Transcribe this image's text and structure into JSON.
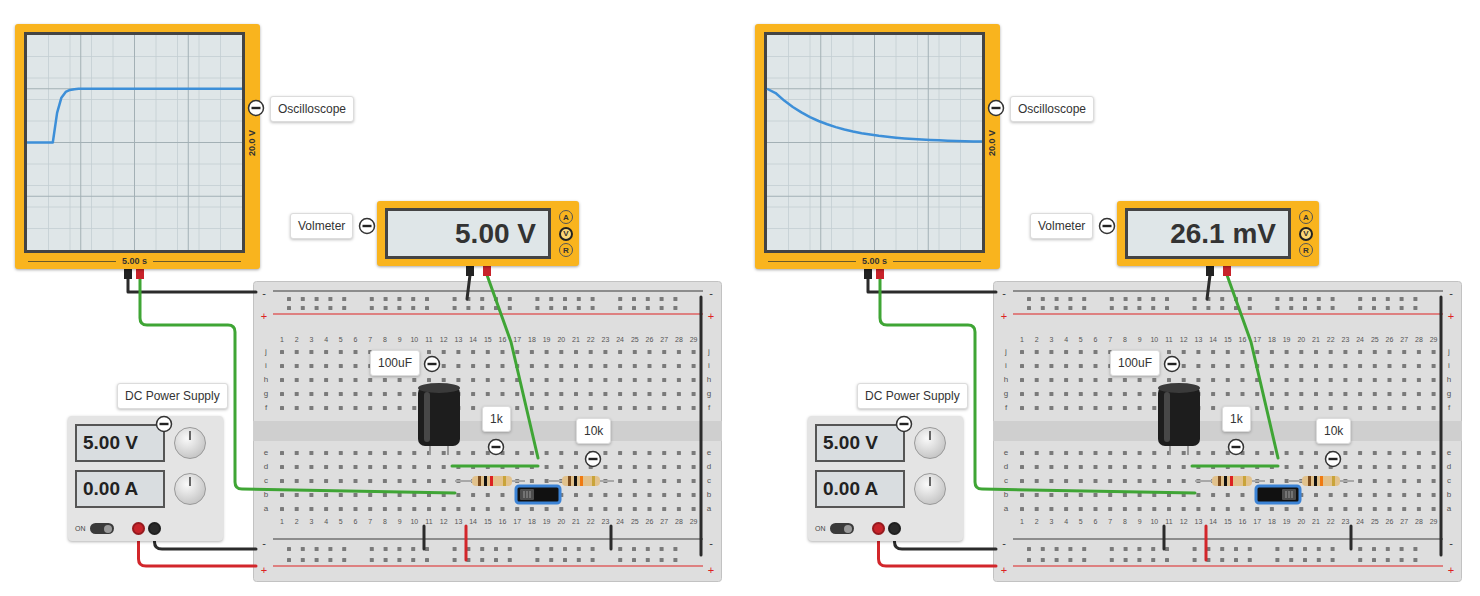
{
  "panels": [
    {
      "oscilloscope": {
        "label": "Oscilloscope",
        "volts_scale": "20.0 V",
        "time_scale": "5.00 s",
        "trace": [
          0,
          0,
          0,
          0,
          0,
          0,
          0,
          2.75,
          4.17,
          4.7,
          4.89,
          4.96,
          4.99,
          5,
          5,
          5,
          5,
          5,
          5,
          5,
          5,
          5,
          5,
          5,
          5,
          5,
          5,
          5,
          5,
          5,
          5,
          5,
          5,
          5,
          5,
          5,
          5,
          5,
          5,
          5,
          5,
          5,
          5,
          5,
          5,
          5,
          5,
          5,
          5,
          5,
          5
        ]
      },
      "voltmeter": {
        "label": "Volmeter",
        "reading": "5.00 V",
        "modes": [
          {
            "label": "A",
            "selected": false
          },
          {
            "label": "V",
            "selected": true
          },
          {
            "label": "R",
            "selected": false
          }
        ]
      },
      "power_supply": {
        "label": "DC Power Supply",
        "voltage": "5.00 V",
        "current": "0.00 A",
        "switch": {
          "label": "ON",
          "on": true
        }
      },
      "components": {
        "capacitor": {
          "label": "100uF"
        },
        "charge_resistor": {
          "label": "1k"
        },
        "discharge_resistor": {
          "label": "10k"
        }
      },
      "slide_switch": {
        "discharge": false
      },
      "breadboard": {
        "columns": [
          "1",
          "2",
          "3",
          "4",
          "5",
          "6",
          "7",
          "8",
          "9",
          "10",
          "11",
          "12",
          "13",
          "14",
          "15",
          "16",
          "17",
          "18",
          "19",
          "20",
          "21",
          "22",
          "23",
          "24",
          "25",
          "26",
          "27",
          "28",
          "29"
        ],
        "rows": [
          "j",
          "i",
          "h",
          "g",
          "f",
          "e",
          "d",
          "c",
          "b",
          "a"
        ],
        "rail_minus": "-",
        "rail_plus": "+"
      }
    },
    {
      "oscilloscope": {
        "label": "Oscilloscope",
        "volts_scale": "20.0 V",
        "time_scale": "5.00 s",
        "trace": [
          5,
          4.6,
          3.9,
          3.3,
          2.8,
          2.36,
          2,
          1.7,
          1.43,
          1.21,
          1.03,
          0.87,
          0.74,
          0.62,
          0.53,
          0.45,
          0.38,
          0.32,
          0.27,
          0.23,
          0.2,
          0.17,
          0.14,
          0.12,
          0.1,
          0.09
        ]
      },
      "voltmeter": {
        "label": "Volmeter",
        "reading": "26.1 mV",
        "modes": [
          {
            "label": "A",
            "selected": false
          },
          {
            "label": "V",
            "selected": true
          },
          {
            "label": "R",
            "selected": false
          }
        ]
      },
      "power_supply": {
        "label": "DC Power Supply",
        "voltage": "5.00 V",
        "current": "0.00 A",
        "switch": {
          "label": "ON",
          "on": true
        }
      },
      "components": {
        "capacitor": {
          "label": "100uF"
        },
        "charge_resistor": {
          "label": "1k"
        },
        "discharge_resistor": {
          "label": "10k"
        }
      },
      "slide_switch": {
        "discharge": true
      },
      "breadboard": {
        "columns": [
          "1",
          "2",
          "3",
          "4",
          "5",
          "6",
          "7",
          "8",
          "9",
          "10",
          "11",
          "12",
          "13",
          "14",
          "15",
          "16",
          "17",
          "18",
          "19",
          "20",
          "21",
          "22",
          "23",
          "24",
          "25",
          "26",
          "27",
          "28",
          "29"
        ],
        "rows": [
          "j",
          "i",
          "h",
          "g",
          "f",
          "e",
          "d",
          "c",
          "b",
          "a"
        ],
        "rail_minus": "-",
        "rail_plus": "+"
      }
    }
  ]
}
